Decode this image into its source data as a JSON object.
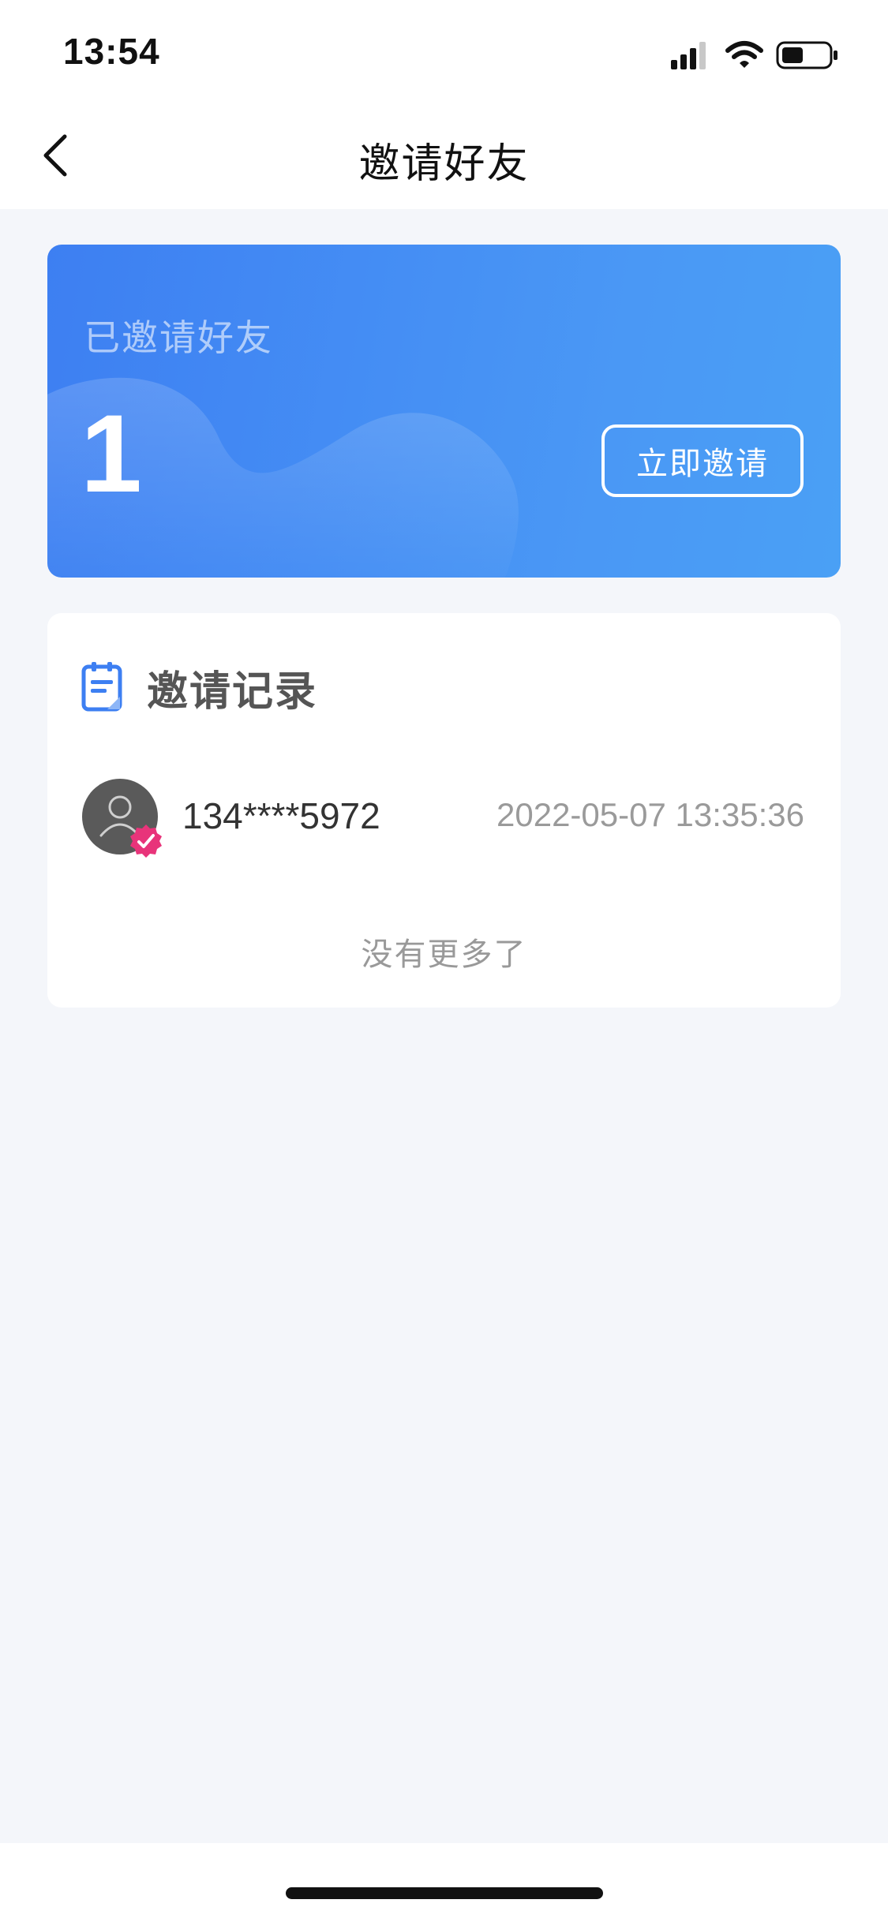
{
  "status_bar": {
    "time": "13:54"
  },
  "nav": {
    "title": "邀请好友"
  },
  "hero": {
    "label": "已邀请好友",
    "count": "1",
    "invite_button": "立即邀请"
  },
  "records": {
    "title": "邀请记录",
    "items": [
      {
        "phone": "134****5972",
        "time": "2022-05-07 13:35:36"
      }
    ],
    "end_text": "没有更多了"
  },
  "colors": {
    "brand_blue": "#3d7ff2",
    "page_background": "#f4f6fa",
    "badge_pink": "#e8347a"
  }
}
